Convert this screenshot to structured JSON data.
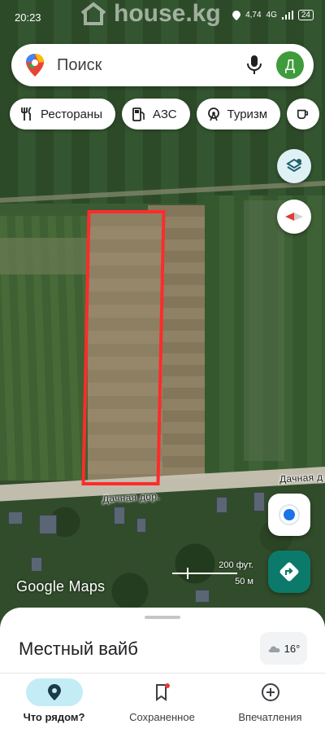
{
  "status_bar": {
    "time": "20:23",
    "watermark": "house.kg",
    "network_speed": "4,74",
    "network_type": "4G",
    "battery": "24"
  },
  "search": {
    "placeholder": "Поиск",
    "avatar_letter": "Д"
  },
  "chips": [
    {
      "label": "Рестораны",
      "icon": "restaurant-icon"
    },
    {
      "label": "АЗС",
      "icon": "gas-station-icon"
    },
    {
      "label": "Туризм",
      "icon": "attraction-icon"
    },
    {
      "label": "",
      "icon": "coffee-icon"
    }
  ],
  "map": {
    "road_labels": [
      "Дачная дор.",
      "Дачная д"
    ],
    "scale_imperial": "200 фут.",
    "scale_metric": "50 м",
    "attribution": "Google Maps",
    "plot_outline_color": "#ff2b2b"
  },
  "sheet": {
    "title": "Местный вайб",
    "weather_temp": "16°"
  },
  "bottom_nav": {
    "items": [
      {
        "label": "Что рядом?",
        "icon": "location-pin-icon",
        "active": true
      },
      {
        "label": "Сохраненное",
        "icon": "bookmark-icon",
        "active": false
      },
      {
        "label": "Впечатления",
        "icon": "add-circle-icon",
        "active": false
      }
    ]
  },
  "colors": {
    "accent_teal": "#0b7a6a",
    "active_nav": "#c4ecf6",
    "avatar_green": "#3f9b3c",
    "location_blue": "#1a73e8"
  }
}
